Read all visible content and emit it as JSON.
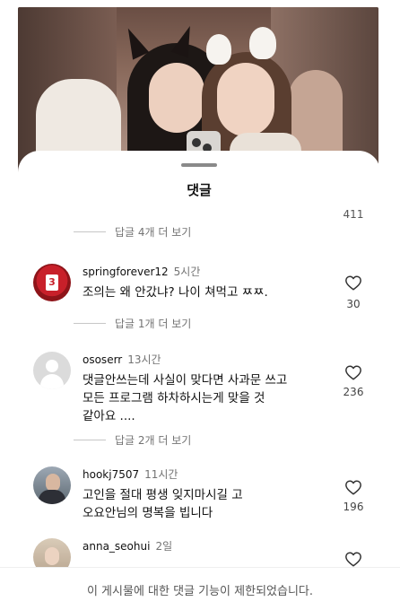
{
  "sheet": {
    "title": "댓글"
  },
  "partial_comment": {
    "likes": "411",
    "reply_link": "답글 4개 더 보기"
  },
  "comments": [
    {
      "username": "springforever12",
      "time": "5시간",
      "text": "조의는 왜 안갔냐? 나이 쳐먹고 ㅉㅉ.",
      "likes": "30",
      "reply_link": "답글 1개 더 보기",
      "avatar_number": "3"
    },
    {
      "username": "ososerr",
      "time": "13시간",
      "text_lines": [
        "댓글안쓰는데 사실이 맞다면 사과문 쓰고",
        "모든 프로그램 하차하시는게 맞을 것",
        "같아요 ...."
      ],
      "likes": "236",
      "reply_link": "답글 2개 더 보기"
    },
    {
      "username": "hookj7507",
      "time": "11시간",
      "text_lines": [
        "고인을 절대 평생 잊지마시길 고",
        "오요안님의 명복을 빕니다"
      ],
      "likes": "196"
    },
    {
      "username": "anna_seohui",
      "time": "2일"
    }
  ],
  "footer": {
    "notice": "이 게시물에 대한 댓글 기능이 제한되었습니다."
  },
  "icons": {
    "like": "heart-outline-icon",
    "default_avatar": "person-silhouette-icon"
  },
  "colors": {
    "secondary_text": "#737373",
    "divider": "#efefef"
  }
}
